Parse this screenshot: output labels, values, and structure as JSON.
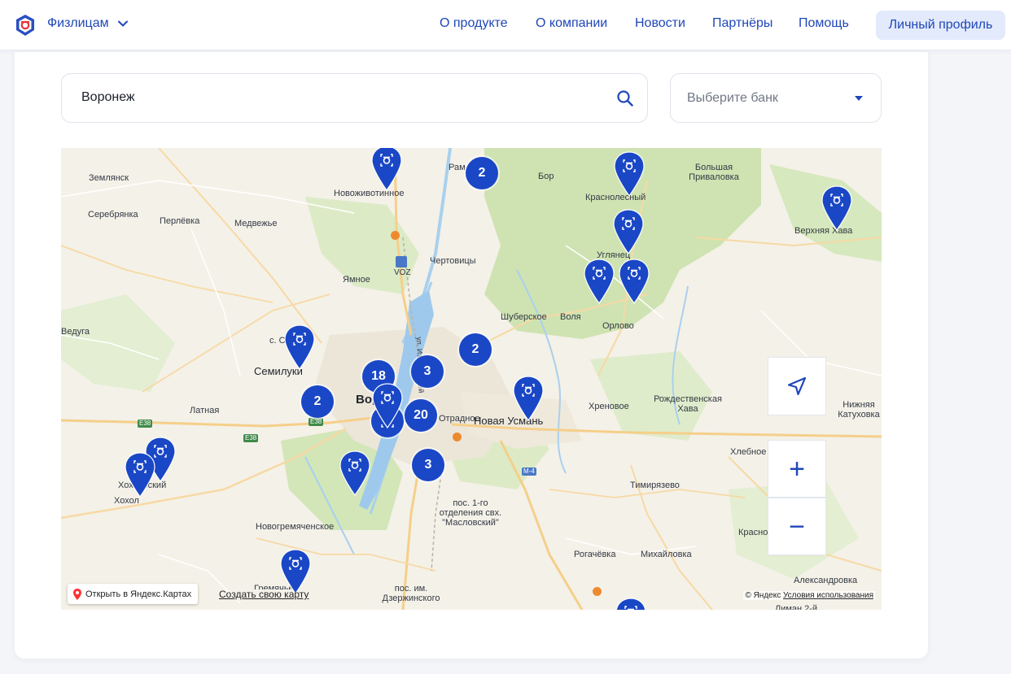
{
  "header": {
    "segment_label": "Физлицам",
    "nav": [
      "О продукте",
      "О компании",
      "Новости",
      "Партнёры",
      "Помощь"
    ],
    "profile_button": "Личный профиль",
    "accent_color": "#1f47b8"
  },
  "search": {
    "value": "Воронеж"
  },
  "bank_select": {
    "label": "Выберите банк"
  },
  "map": {
    "places": [
      "Землянск",
      "Серебрянка",
      "Перлёвка",
      "Медвежье",
      "Новоживотинное",
      "Рамонь",
      "Бор",
      "Краснолесный",
      "Большая Приваловка",
      "Верхняя Хава",
      "Углянец",
      "Чертовицы",
      "VOZ",
      "Ямное",
      "ул. Изыскателей",
      "Шуберское",
      "Воля",
      "Орлово",
      "Ведуга",
      "с. Орлов Лог",
      "Семилуки",
      "Латная",
      "Воронеж",
      "Отрадное",
      "Новая Усмань",
      "Хреновое",
      "Рождественская Хава",
      "Нижняя Катуховка",
      "Хлебное",
      "Хохольский",
      "Хохол",
      "Тимирязево",
      "пос. 1-го отделения свх. \"Масловский\"",
      "Новогремяченское",
      "Рогачёвка",
      "Михайловка",
      "Краснолесье",
      "Александровка",
      "Лиман 2-й",
      "пос. им. Дзержинского",
      "Гремячье"
    ],
    "road_labels": [
      "E38",
      "E38",
      "E38",
      "M-4"
    ],
    "clusters": [
      "2",
      "2",
      "18",
      "3",
      "2",
      "20",
      "3"
    ],
    "controls": {
      "locate_icon": "navigation-arrow-icon",
      "zoom_in": "+",
      "zoom_out": "−"
    },
    "footer": {
      "open_in_yandex": "Открыть в Яндекс.Картах",
      "create_map": "Создать свою карту",
      "copyright": "© Яндекс",
      "terms": "Условия использования"
    },
    "pin_color": "#1a47c6"
  }
}
